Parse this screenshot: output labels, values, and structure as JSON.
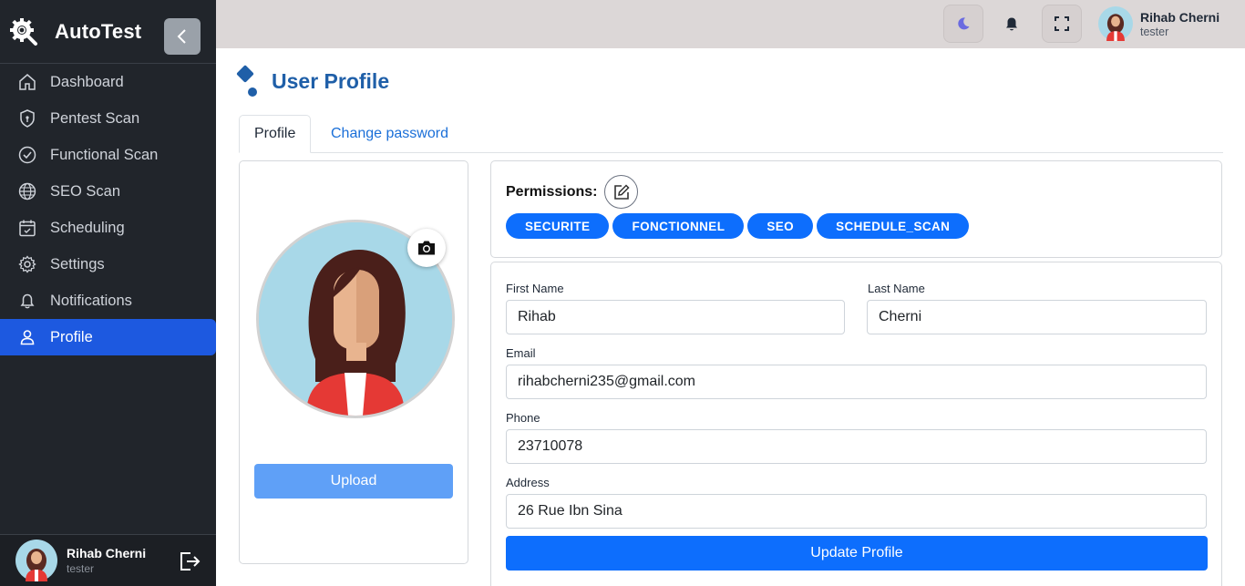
{
  "app": {
    "brand": "AutoTest"
  },
  "sidebar": {
    "items": [
      {
        "label": "Dashboard",
        "icon": "home-icon"
      },
      {
        "label": "Pentest Scan",
        "icon": "shield-icon"
      },
      {
        "label": "Functional Scan",
        "icon": "check-circle-icon"
      },
      {
        "label": "SEO Scan",
        "icon": "globe-icon"
      },
      {
        "label": "Scheduling",
        "icon": "calendar-icon"
      },
      {
        "label": "Settings",
        "icon": "gear-icon"
      },
      {
        "label": "Notifications",
        "icon": "bell-icon"
      },
      {
        "label": "Profile",
        "icon": "user-icon",
        "active": true
      }
    ],
    "footer_user": {
      "name": "Rihab Cherni",
      "role": "tester"
    }
  },
  "header": {
    "user": {
      "name": "Rihab Cherni",
      "role": "tester"
    }
  },
  "page": {
    "title": "User Profile"
  },
  "tabs": [
    {
      "label": "Profile",
      "active": true
    },
    {
      "label": "Change password",
      "active": false
    }
  ],
  "photo": {
    "upload_label": "Upload"
  },
  "permissions": {
    "label": "Permissions:",
    "items": [
      "SECURITE",
      "FONCTIONNEL",
      "SEO",
      "SCHEDULE_SCAN"
    ]
  },
  "form": {
    "first_name": {
      "label": "First Name",
      "value": "Rihab"
    },
    "last_name": {
      "label": "Last Name",
      "value": "Cherni"
    },
    "email": {
      "label": "Email",
      "value": "rihabcherni235@gmail.com"
    },
    "phone": {
      "label": "Phone",
      "value": "23710078"
    },
    "address": {
      "label": "Address",
      "value": "26 Rue Ibn Sina"
    },
    "submit_label": "Update Profile"
  },
  "colors": {
    "accent": "#0d6efd",
    "sidebar_bg": "#21252b",
    "active_nav": "#1d59e0",
    "title": "#1f5fa8"
  }
}
